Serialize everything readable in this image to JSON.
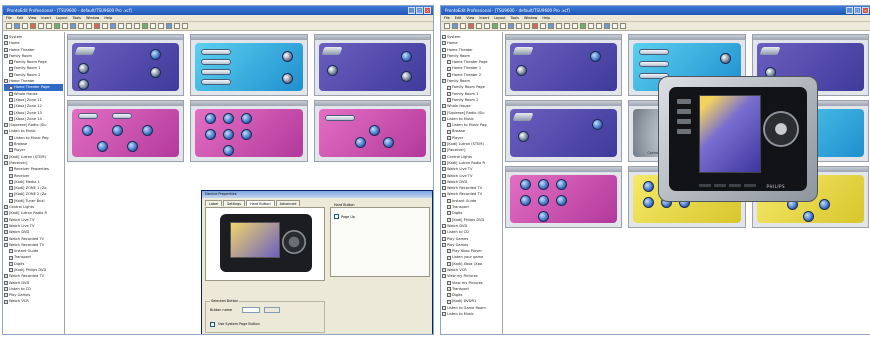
{
  "left": {
    "title": "ProntoEdit Professional - [TSU9600 - default/TSU9600 Pro .xcf]",
    "menu": [
      "File",
      "Edit",
      "View",
      "Insert",
      "Layout",
      "Tools",
      "Window",
      "Help"
    ],
    "tree": [
      {
        "label": "System",
        "level": 0
      },
      {
        "label": "Home",
        "level": 0
      },
      {
        "label": "Home Theater",
        "level": 0
      },
      {
        "label": "Family Room",
        "level": 0
      },
      {
        "label": "Family Room Page",
        "level": 1
      },
      {
        "label": "Family Room 1",
        "level": 1
      },
      {
        "label": "Family Room 2",
        "level": 1
      },
      {
        "label": "Home Theater",
        "level": 0
      },
      {
        "label": "Home Theater Page",
        "level": 1,
        "selected": true
      },
      {
        "label": "Whole House",
        "level": 1
      },
      {
        "label": "[Xbox] Zone 11",
        "level": 1
      },
      {
        "label": "[Xbox] Zone 12",
        "level": 1
      },
      {
        "label": "[Xbox] Zone 13",
        "level": 1
      },
      {
        "label": "[Xbox] Zone 14",
        "level": 1
      },
      {
        "label": "[Squeeze] Radio (Slu",
        "level": 0
      },
      {
        "label": "Listen to Music",
        "level": 0
      },
      {
        "label": "Listen to Music Pag",
        "level": 1
      },
      {
        "label": "Browse",
        "level": 1
      },
      {
        "label": "Player",
        "level": 1
      },
      {
        "label": "[Kodi] Lutron (STEM)",
        "level": 0
      },
      {
        "label": "[Receiver]",
        "level": 0
      },
      {
        "label": "Receiver Properties",
        "level": 1
      },
      {
        "label": "Receiver",
        "level": 1
      },
      {
        "label": "[Kodi] Media 1",
        "level": 1
      },
      {
        "label": "[Kodi] ZONE 1 (Zo",
        "level": 1
      },
      {
        "label": "[Kodi] ZONE 2 (Zo",
        "level": 1
      },
      {
        "label": "[Kodi] Tuner Bnxl",
        "level": 1
      },
      {
        "label": "Control Lights",
        "level": 0
      },
      {
        "label": "[Kodi] Lutron Radio R",
        "level": 0
      },
      {
        "label": "Watch Live TV",
        "level": 0
      },
      {
        "label": "Watch Live TV",
        "level": 0
      },
      {
        "label": "Watch DVD",
        "level": 0
      },
      {
        "label": "Watch Recorded TV",
        "level": 0
      },
      {
        "label": "Watch Recorded TV",
        "level": 0
      },
      {
        "label": "Instant Guide",
        "level": 1
      },
      {
        "label": "Transport",
        "level": 1
      },
      {
        "label": "Digits",
        "level": 1
      },
      {
        "label": "[Kodi] Philips DVD",
        "level": 1
      },
      {
        "label": "Watch Recorded TV",
        "level": 0
      },
      {
        "label": "Watch DVD",
        "level": 0
      },
      {
        "label": "Listen to CD",
        "level": 0
      },
      {
        "label": "Play Games",
        "level": 0
      },
      {
        "label": "Watch VCR",
        "level": 0
      }
    ],
    "dialog": {
      "title": "Device Properties",
      "tabs": [
        "Label",
        "Settings",
        "Hard Button",
        "Advanced"
      ],
      "active_tab": "Hard Button",
      "right_header": "Hard Button",
      "right_item": "Page Up",
      "group_label": "Selected Button",
      "field_label": "Button name",
      "check_label": "Use System Page Button"
    }
  },
  "right": {
    "title": "ProntoEdit Professional - [TSU9600 - default/TSU9600 Pro .xcf]",
    "menu": [
      "File",
      "Edit",
      "View",
      "Insert",
      "Layout",
      "Tools",
      "Window",
      "Help"
    ],
    "tree": [
      {
        "label": "System",
        "level": 0
      },
      {
        "label": "Home",
        "level": 0
      },
      {
        "label": "Home Theater",
        "level": 0
      },
      {
        "label": "Family Room",
        "level": 0
      },
      {
        "label": "Home Theater Page",
        "level": 1
      },
      {
        "label": "Home Theater 1",
        "level": 1
      },
      {
        "label": "Home Theater 2",
        "level": 1
      },
      {
        "label": "Family Room",
        "level": 0
      },
      {
        "label": "Family Room Page",
        "level": 1
      },
      {
        "label": "Family Room 1",
        "level": 1
      },
      {
        "label": "Family Room 2",
        "level": 1
      },
      {
        "label": "Whole House",
        "level": 0
      },
      {
        "label": "[Squeeze] Radio (Slu",
        "level": 0
      },
      {
        "label": "Listen to Music",
        "level": 0
      },
      {
        "label": "Listen to Music Pag",
        "level": 1
      },
      {
        "label": "Browse",
        "level": 1
      },
      {
        "label": "Player",
        "level": 1
      },
      {
        "label": "[Kodi] Lutron (STEM)",
        "level": 0
      },
      {
        "label": "[Receiver]",
        "level": 0
      },
      {
        "label": "Control Lights",
        "level": 0
      },
      {
        "label": "[Kodi] Lutron Radio R",
        "level": 0
      },
      {
        "label": "Watch Live TV",
        "level": 0
      },
      {
        "label": "Watch Live TV",
        "level": 0
      },
      {
        "label": "Watch DVD",
        "level": 0
      },
      {
        "label": "Watch Recorded TV",
        "level": 0
      },
      {
        "label": "Watch Recorded TV",
        "level": 0
      },
      {
        "label": "Instant Guide",
        "level": 1
      },
      {
        "label": "Transport",
        "level": 1
      },
      {
        "label": "Digits",
        "level": 1
      },
      {
        "label": "[Kodi] Philips DVD",
        "level": 1
      },
      {
        "label": "Watch DVD",
        "level": 0
      },
      {
        "label": "Listen to CD",
        "level": 0
      },
      {
        "label": "Play Games",
        "level": 0
      },
      {
        "label": "Play Games",
        "level": 0
      },
      {
        "label": "Play Xbox Player",
        "level": 1
      },
      {
        "label": "Listen your game",
        "level": 1
      },
      {
        "label": "[Kodi] Xbox (Xbo",
        "level": 1
      },
      {
        "label": "Watch VCR",
        "level": 0
      },
      {
        "label": "View my Pictures",
        "level": 0
      },
      {
        "label": "View my Pictures",
        "level": 1
      },
      {
        "label": "Transport",
        "level": 1
      },
      {
        "label": "Digits",
        "level": 1
      },
      {
        "label": "[Kodi] DVDR1",
        "level": 1
      },
      {
        "label": "Listen to Game Room",
        "level": 0
      },
      {
        "label": "Listen to Music",
        "level": 0
      }
    ],
    "thumb_caption": "Connect with A/V set game console",
    "device_brand": "PHILIPS"
  }
}
